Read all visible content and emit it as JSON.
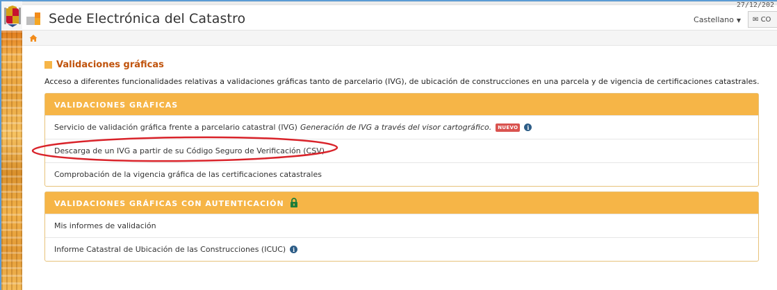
{
  "header": {
    "date": "27/12/202",
    "title": "Sede Electrónica del Catastro",
    "language": "Castellano",
    "contact_label": "CO"
  },
  "page": {
    "title": "Validaciones gráficas",
    "intro": "Acceso a diferentes funcionalidades relativas a validaciones gráficas tanto de parcelario (IVG), de ubicación de construcciones en una parcela y de vigencia de certificaciones catastrales."
  },
  "panels": [
    {
      "heading": "VALIDACIONES GRÁFICAS",
      "rows": [
        {
          "label": "Servicio de validación gráfica frente a parcelario catastral (IVG)",
          "italic": "Generación de IVG a través del visor cartográfico.",
          "badge": "NUEVO"
        },
        {
          "label": "Descarga de un IVG a partir de su Código Seguro de Verificación (CSV)"
        },
        {
          "label": "Comprobación de la vigencia gráfica de las certificaciones catastrales"
        }
      ]
    },
    {
      "heading": "VALIDACIONES GRÁFICAS CON AUTENTICACIÓN",
      "rows": [
        {
          "label": "Mis informes de validación"
        },
        {
          "label": "Informe Catastral de Ubicación de las Construcciones (ICUC)"
        }
      ]
    }
  ],
  "colors": {
    "accent_orange": "#f6b547",
    "title_orange": "#c0530c",
    "badge_red": "#d9534f",
    "info_blue": "#2d5d87",
    "highlight_red": "#d9232a"
  },
  "icons": {
    "home": "home-icon",
    "info": "info-icon",
    "lock": "lock-icon",
    "mail": "mail-icon",
    "caret": "chevron-down-icon"
  }
}
